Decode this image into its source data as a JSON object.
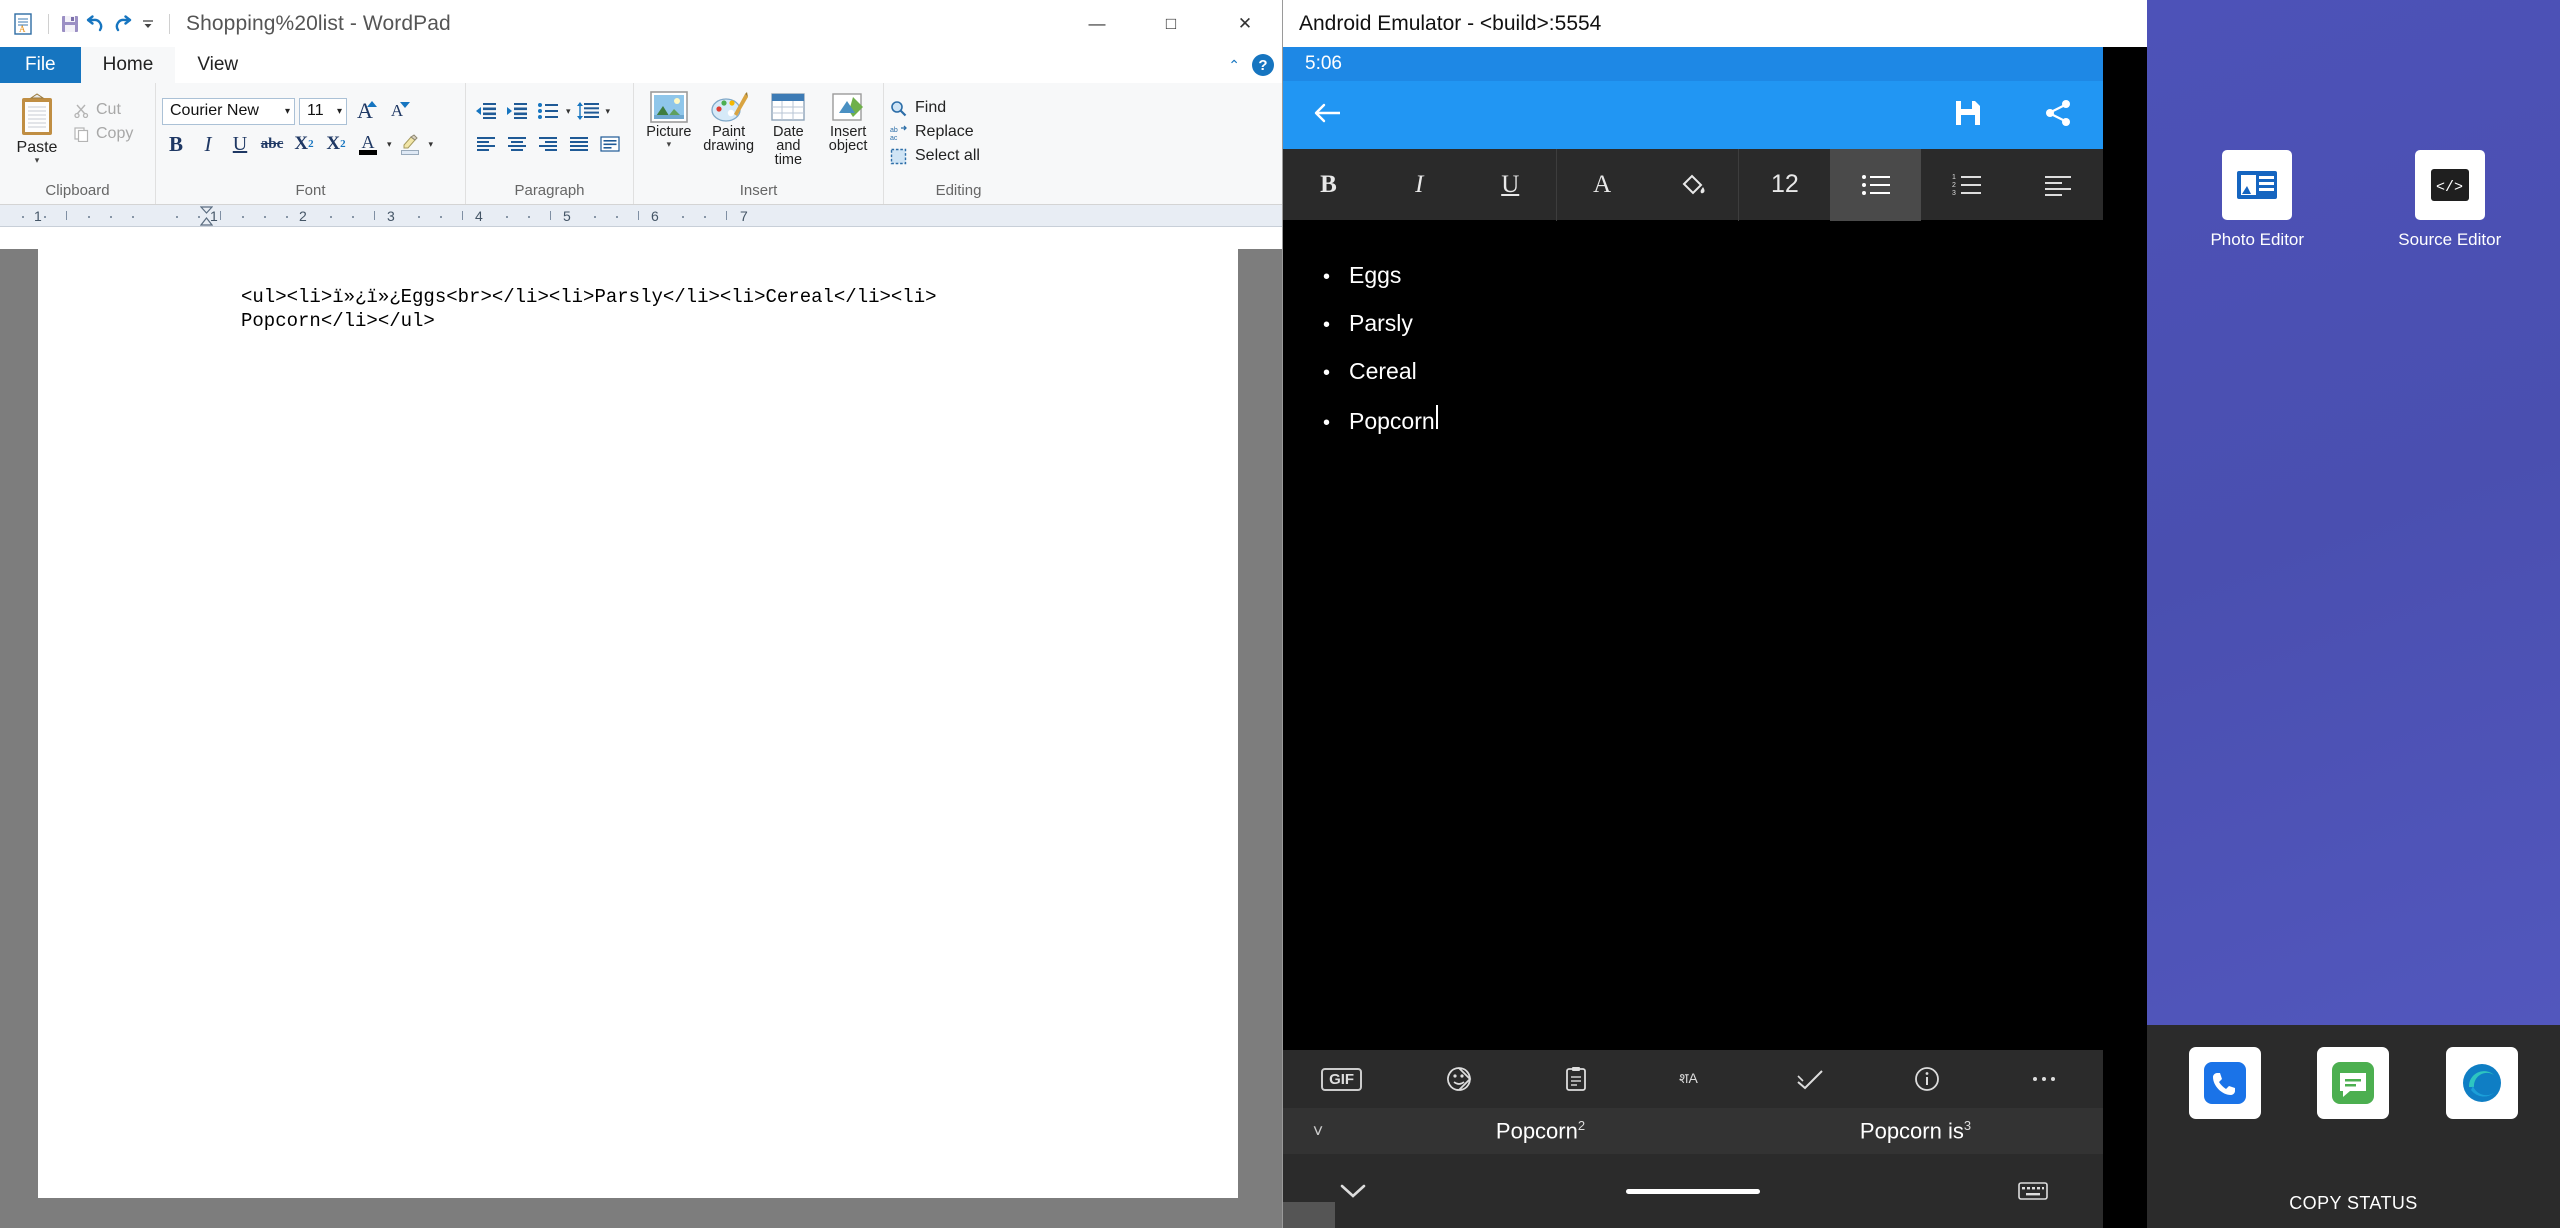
{
  "wordpad": {
    "window_title": "Shopping%20list - WordPad",
    "quick_access": [
      {
        "name": "app-icon",
        "glyph": "☰"
      },
      {
        "name": "save-icon",
        "glyph": "💾"
      },
      {
        "name": "undo-icon",
        "glyph": "↶"
      },
      {
        "name": "redo-icon",
        "glyph": "↷"
      },
      {
        "name": "customize-qat-icon",
        "glyph": "▾"
      }
    ],
    "window_controls": {
      "minimize": "—",
      "maximize": "□",
      "close": "✕"
    },
    "tabs": [
      {
        "label": "File",
        "active": false,
        "kind": "file"
      },
      {
        "label": "Home",
        "active": true,
        "kind": "tab"
      },
      {
        "label": "View",
        "active": false,
        "kind": "tab"
      }
    ],
    "help_label": "?",
    "ribbon_collapse": "⌃",
    "groups": {
      "clipboard": {
        "label": "Clipboard",
        "paste_label": "Paste",
        "cut_label": "Cut",
        "copy_label": "Copy"
      },
      "font": {
        "label": "Font",
        "font_name": "Courier New",
        "font_size": "11",
        "grow_label": "A",
        "shrink_label": "A",
        "bold_label": "B",
        "italic_label": "I",
        "underline_label": "U",
        "strikethrough_label": "abc",
        "subscript_label": "X",
        "subscript_sub": "2",
        "superscript_label": "X",
        "superscript_sup": "2",
        "text_color_label": "A",
        "text_color": "#000000",
        "highlight_color": "#dfe9f5"
      },
      "paragraph": {
        "label": "Paragraph",
        "decrease_indent": "decrease-indent-icon",
        "increase_indent": "increase-indent-icon",
        "bullets": "bullet-list-icon",
        "line_spacing": "line-spacing-icon",
        "align_left": "align-left-icon",
        "align_center": "align-center-icon",
        "align_right": "align-right-icon",
        "align_justify": "align-justify-icon",
        "paragraph_settings": "paragraph-settings-icon"
      },
      "insert": {
        "label": "Insert",
        "items": [
          {
            "label": "Picture",
            "icon": "picture-icon",
            "caret": true
          },
          {
            "label": "Paint\ndrawing",
            "icon": "paint-drawing-icon",
            "caret": false
          },
          {
            "label": "Date and\ntime",
            "icon": "date-time-icon",
            "caret": false
          },
          {
            "label": "Insert\nobject",
            "icon": "insert-object-icon",
            "caret": false
          }
        ]
      },
      "editing": {
        "label": "Editing",
        "find_label": "Find",
        "replace_label": "Replace",
        "select_all_label": "Select all"
      }
    },
    "ruler": {
      "numbers": [
        "1",
        "2",
        "3",
        "4",
        "5",
        "6",
        "7"
      ]
    },
    "document": {
      "text": "<ul><li>ï»¿ï»¿Eggs<br></li><li>Parsly</li><li>Cereal</li><li>\nPopcorn</li></ul>"
    }
  },
  "emulator": {
    "window_title": "Android Emulator - <build>:5554",
    "status_time": "5:06",
    "appbar": {
      "back_icon": "back-arrow-icon",
      "save_icon": "save-icon",
      "share_icon": "share-icon"
    },
    "format_bar": [
      {
        "name": "bold-button",
        "label": "B",
        "style": "bold",
        "active": false
      },
      {
        "name": "italic-button",
        "label": "I",
        "style": "italic",
        "active": false
      },
      {
        "name": "underline-button",
        "label": "U",
        "style": "underline",
        "active": false
      },
      {
        "name": "text-color-button",
        "label": "A",
        "style": "plain",
        "active": false
      },
      {
        "name": "fill-color-button",
        "label": "✐",
        "style": "fill",
        "active": false
      },
      {
        "name": "font-size-button",
        "label": "12",
        "style": "plain",
        "active": false
      },
      {
        "name": "bulleted-list-button",
        "label": "☰",
        "style": "bullets",
        "active": true
      },
      {
        "name": "numbered-list-button",
        "label": "☰",
        "style": "numbers",
        "active": false
      },
      {
        "name": "align-button",
        "label": "☰",
        "style": "align",
        "active": false
      }
    ],
    "note_items": [
      "Eggs",
      "Parsly",
      "Cereal",
      "Popcorn"
    ],
    "bullet_glyph": "•",
    "cursor_after": "Popcorn",
    "keyboard_toolbar": [
      {
        "name": "gif-icon",
        "label": "GIF"
      },
      {
        "name": "sticker-icon",
        "label": "☺"
      },
      {
        "name": "clipboard-icon",
        "label": "📋"
      },
      {
        "name": "translate-icon",
        "label": "文A"
      },
      {
        "name": "handwriting-icon",
        "label": "✓"
      },
      {
        "name": "info-icon",
        "label": "ⓘ"
      },
      {
        "name": "more-icon",
        "label": "⋯"
      }
    ],
    "suggestions": {
      "collapse_icon": "chevron-collapse-icon",
      "items": [
        {
          "word": "Popcorn",
          "index": "2"
        },
        {
          "word": "Popcorn is",
          "index": "3"
        }
      ]
    },
    "navbar": {
      "down_icon": "chevron-down-icon",
      "home_indicator": "home-indicator",
      "keyboard_icon": "keyboard-icon"
    }
  },
  "desktop": {
    "icons": [
      {
        "label": "Photo Editor",
        "icon": "photo-editor-icon"
      },
      {
        "label": "Source Editor",
        "icon": "source-editor-icon"
      }
    ],
    "taskbar": {
      "items": [
        {
          "name": "phone-icon"
        },
        {
          "name": "messages-icon"
        },
        {
          "name": "edge-icon"
        }
      ],
      "status_text": "COPY STATUS"
    }
  },
  "colors": {
    "wordpad_accent": "#1675c0",
    "emulator_appbar": "#2196f3",
    "emulator_statusbar": "#1e88e5",
    "desktop_wallpaper": "#4a4fb0",
    "taskbar": "#2b2b2b"
  }
}
